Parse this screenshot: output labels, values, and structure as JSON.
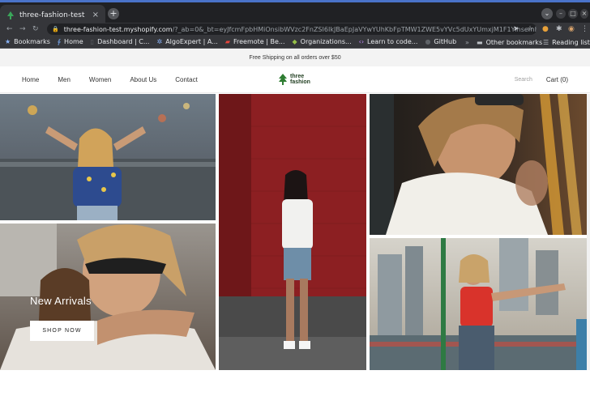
{
  "browser": {
    "tab_title": "three-fashion-test",
    "tab_close": "×",
    "new_tab": "+",
    "url_host": "three-fashion-test.myshopify.com",
    "url_path": "/?_ab=0&_bt=eyJfcmFpbHMiOnsibWVzc2FnZSI6IkJBaEpJaVYwYUhKbFpTMW1ZWE5vYVc5dUxYUmxjM1F1YlhsemFHOXdhV1o1TG1O...",
    "bookmarks": [
      {
        "label": "Bookmarks",
        "icon": "star-icon"
      },
      {
        "label": "Home",
        "icon": "bookmark-icon"
      },
      {
        "label": "Dashboard | C...",
        "icon": "page-icon"
      },
      {
        "label": "AlgoExpert | A...",
        "icon": "algoexpert-icon"
      },
      {
        "label": "Freemote | Be...",
        "icon": "freemote-icon"
      },
      {
        "label": "Organizations...",
        "icon": "shopify-icon"
      },
      {
        "label": "Learn to code...",
        "icon": "code-icon"
      },
      {
        "label": "GitHub",
        "icon": "github-icon"
      }
    ],
    "other_bookmarks": "Other bookmarks",
    "reading_list": "Reading list",
    "colors": {
      "tabstrip": "#202124",
      "toolbar": "#35363a",
      "accent": "#4a73c9"
    }
  },
  "store": {
    "announcement": "Free Shipping on all orders over $50",
    "nav": [
      "Home",
      "Men",
      "Women",
      "About Us",
      "Contact"
    ],
    "logo_line1": "three",
    "logo_line2": "fashion",
    "search_placeholder": "Search",
    "cart_label": "Cart (0)",
    "hero": {
      "title": "New Arrivals",
      "button_label": "SHOP NOW"
    },
    "colors": {
      "logo_green": "#2f7d32",
      "announcement_bg": "#f3f3f3"
    }
  }
}
